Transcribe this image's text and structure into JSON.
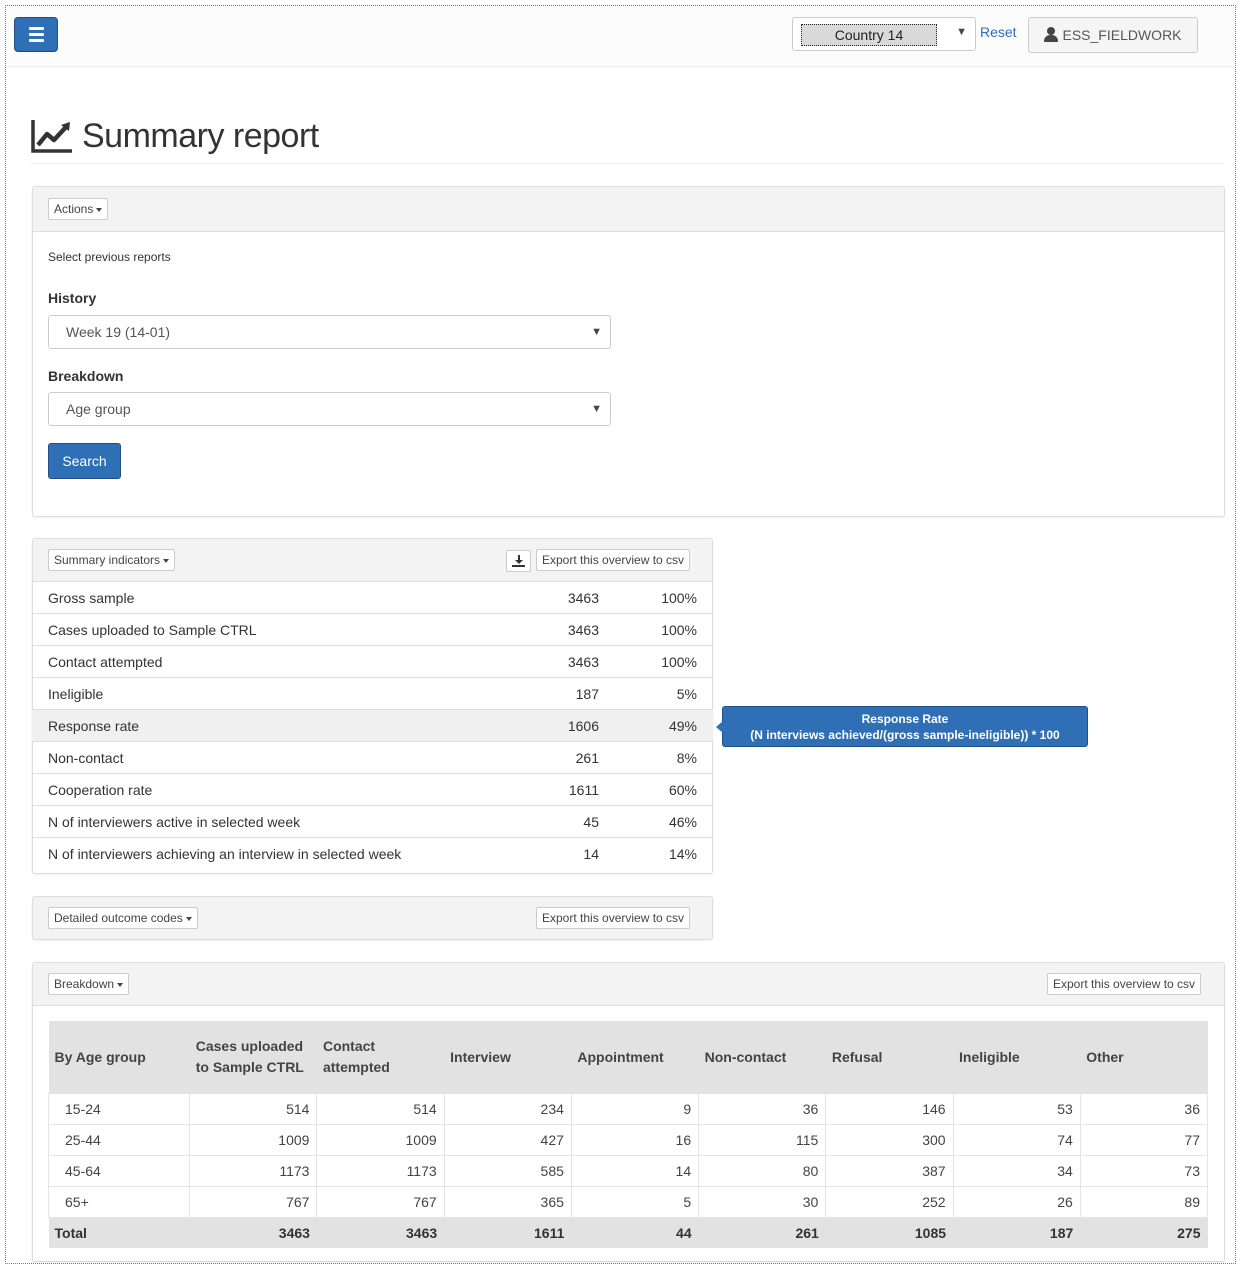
{
  "navbar": {
    "country": "Country 14",
    "reset": "Reset",
    "user": "ESS_FIELDWORK"
  },
  "page": {
    "title": "Summary report"
  },
  "report_panel": {
    "actions": "Actions",
    "select_prev": "Select previous reports",
    "history_label": "History",
    "history_value": "Week 19 (14-01)",
    "breakdown_label": "Breakdown",
    "breakdown_value": "Age group",
    "search": "Search"
  },
  "summary": {
    "menu": "Summary indicators",
    "export": "Export this overview to csv",
    "rows": [
      {
        "name": "Gross sample",
        "n": "3463",
        "pct": "100%"
      },
      {
        "name": "Cases uploaded to Sample CTRL",
        "n": "3463",
        "pct": "100%"
      },
      {
        "name": "Contact attempted",
        "n": "3463",
        "pct": "100%"
      },
      {
        "name": "Ineligible",
        "n": "187",
        "pct": "5%"
      },
      {
        "name": "Response rate",
        "n": "1606",
        "pct": "49%"
      },
      {
        "name": "Non-contact",
        "n": "261",
        "pct": "8%"
      },
      {
        "name": "Cooperation rate",
        "n": "1611",
        "pct": "60%"
      },
      {
        "name": "N of interviewers active in selected week",
        "n": "45",
        "pct": "46%"
      },
      {
        "name": "N of interviewers achieving an interview in selected week",
        "n": "14",
        "pct": "14%"
      }
    ]
  },
  "tooltip": {
    "title": "Response Rate",
    "formula": "(N interviews achieved/(gross sample-ineligible)) * 100"
  },
  "outcome": {
    "menu": "Detailed outcome codes",
    "export": "Export this overview to csv"
  },
  "breakdown": {
    "menu": "Breakdown",
    "export": "Export this overview to csv",
    "headers": [
      "By Age group",
      "Cases uploaded to Sample CTRL",
      "Contact attempted",
      "Interview",
      "Appointment",
      "Non-contact",
      "Refusal",
      "Ineligible",
      "Other"
    ],
    "rows": [
      [
        "15-24",
        "514",
        "514",
        "234",
        "9",
        "36",
        "146",
        "53",
        "36"
      ],
      [
        "25-44",
        "1009",
        "1009",
        "427",
        "16",
        "115",
        "300",
        "74",
        "77"
      ],
      [
        "45-64",
        "1173",
        "1173",
        "585",
        "14",
        "80",
        "387",
        "34",
        "73"
      ],
      [
        "65+",
        "767",
        "767",
        "365",
        "5",
        "30",
        "252",
        "26",
        "89"
      ]
    ],
    "total": [
      "Total",
      "3463",
      "3463",
      "1611",
      "44",
      "261",
      "1085",
      "187",
      "275"
    ]
  }
}
